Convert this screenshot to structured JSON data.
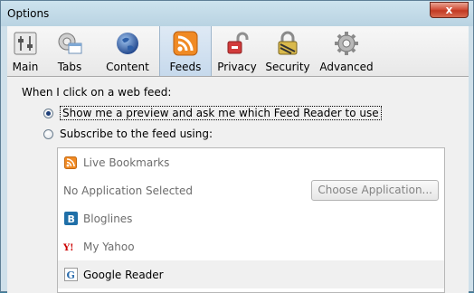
{
  "window": {
    "title": "Options",
    "close_label": "x"
  },
  "toolbar": {
    "items": [
      {
        "label": "Main",
        "icon": "main-panel-icon"
      },
      {
        "label": "Tabs",
        "icon": "tabs-icon"
      },
      {
        "label": "Content",
        "icon": "content-globe-icon"
      },
      {
        "label": "Feeds",
        "icon": "rss-feed-icon",
        "selected": true
      },
      {
        "label": "Privacy",
        "icon": "privacy-lock-icon"
      },
      {
        "label": "Security",
        "icon": "security-padlock-icon"
      },
      {
        "label": "Advanced",
        "icon": "advanced-gear-icon"
      }
    ]
  },
  "feeds": {
    "heading": "When I click on a web feed:",
    "option_preview": "Show me a preview and ask me which Feed Reader to use",
    "option_subscribe": "Subscribe to the feed using:",
    "selected_option": "preview",
    "readers": [
      {
        "label": "Live Bookmarks",
        "icon": "rss-small-icon"
      },
      {
        "label": "No Application Selected",
        "button": "Choose Application..."
      },
      {
        "label": "Bloglines",
        "icon": "bloglines-icon"
      },
      {
        "label": "My Yahoo",
        "icon": "yahoo-icon"
      },
      {
        "label": "Google Reader",
        "icon": "google-icon"
      }
    ]
  },
  "colors": {
    "accent": "#2f6fae",
    "rss_orange": "#f08a24",
    "selection": "#c6d9ec"
  }
}
